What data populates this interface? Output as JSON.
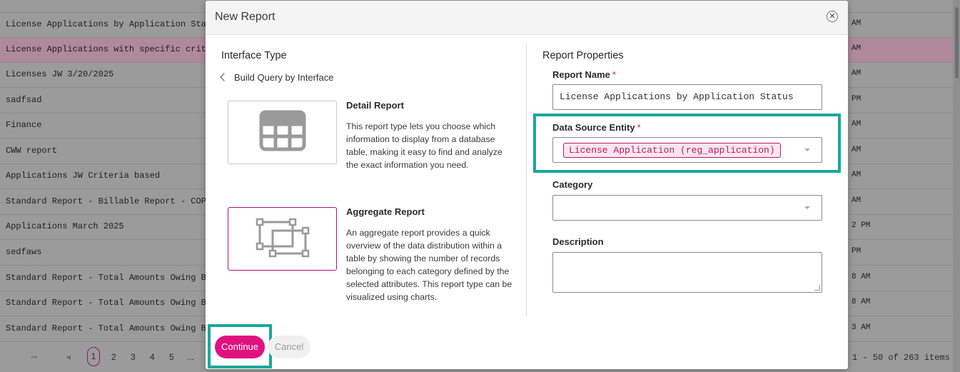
{
  "background_list": {
    "rows": [
      {
        "name": "License Applications by Application Status",
        "time": "AM"
      },
      {
        "name": "License Applications with specific criteria",
        "time": "AM"
      },
      {
        "name": "Licenses JW 3/20/2025",
        "time": "AM"
      },
      {
        "name": "sadfsad",
        "time": "PM"
      },
      {
        "name": "Finance",
        "time": "AM"
      },
      {
        "name": "CWW report",
        "time": "AM"
      },
      {
        "name": "Applications JW Criteria based",
        "time": "AM"
      },
      {
        "name": "Standard Report - Billable Report - COPY",
        "time": "AM"
      },
      {
        "name": "Applications March 2025",
        "time": "2 PM"
      },
      {
        "name": "sedfaws",
        "time": "PM"
      },
      {
        "name": "Standard Report - Total Amounts Owing By Fee",
        "time": "8 AM"
      },
      {
        "name": "Standard Report - Total Amounts Owing By Fee",
        "time": "8 AM"
      },
      {
        "name": "Standard Report - Total Amounts Owing By Fee",
        "time": "3 AM"
      }
    ],
    "pager": {
      "first": "⏮",
      "prev": "◀",
      "current": "1",
      "pages": [
        "2",
        "3",
        "4",
        "5",
        "..."
      ],
      "info": "1 - 50 of 263 items"
    }
  },
  "modal": {
    "title": "New Report",
    "close_symbol": "✕",
    "left": {
      "heading": "Interface Type",
      "back_label": "Build Query by Interface",
      "detail": {
        "name": "Detail Report",
        "description": "This report type lets you choose which information to display from a database table, making it easy to find and analyze the exact information you need."
      },
      "aggregate": {
        "name": "Aggregate Report",
        "description": "An aggregate report provides a quick overview of the data distribution within a table by showing the number of records belonging to each category defined by the selected attributes. This report type can be visualized using charts."
      }
    },
    "right": {
      "heading": "Report Properties",
      "report_name_label": "Report Name",
      "report_name_value": "License Applications by Application Status",
      "data_source_label": "Data Source Entity",
      "data_source_value": "License Application (reg_application)",
      "category_label": "Category",
      "category_value": "",
      "description_label": "Description",
      "description_value": "",
      "required_mark": "*"
    },
    "footer": {
      "continue_label": "Continue",
      "cancel_label": "Cancel"
    }
  },
  "colors": {
    "accent": "#e0117f",
    "highlight_box": "#1aa89a",
    "chip_border": "#c2185b"
  }
}
